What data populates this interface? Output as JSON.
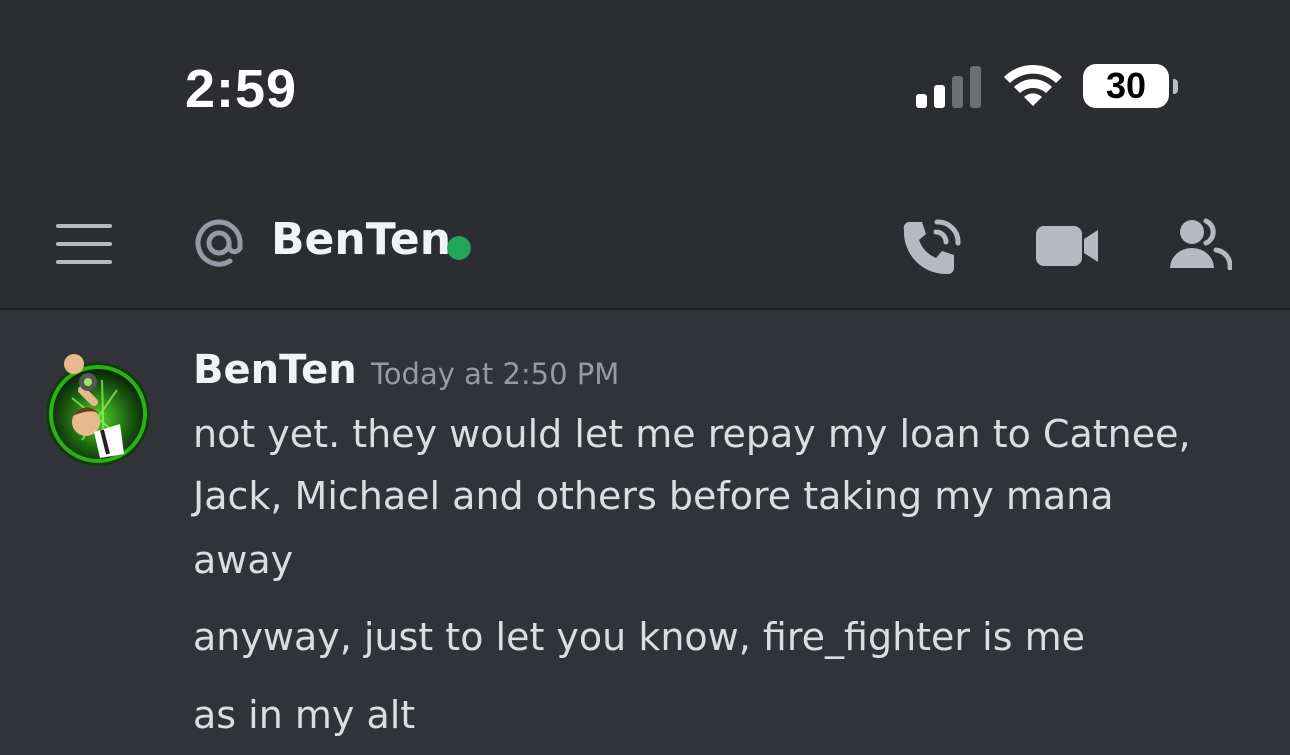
{
  "status_bar": {
    "time": "2:59",
    "battery_level": "30",
    "signal_icon": "cellular-signal-icon",
    "wifi_icon": "wifi-icon"
  },
  "header": {
    "channel_icon": "at-icon",
    "recipient_name": "BenTen",
    "online_status_color": "#23a55a",
    "actions": [
      "voice-call-icon",
      "video-call-icon",
      "members-icon"
    ]
  },
  "messages": {
    "author": "BenTen",
    "timestamp": "Today at 2:50 PM",
    "lines": [
      "not yet. they would let me repay my loan to Catnee,",
      "Jack, Michael and others before taking my mana",
      "away",
      "anyway, just to let you know, fire_fighter is me",
      "as in my alt"
    ]
  },
  "colors": {
    "background": "#313338",
    "header_background": "#2b2d31",
    "online": "#23a55a",
    "muted_text": "#949ba4"
  }
}
